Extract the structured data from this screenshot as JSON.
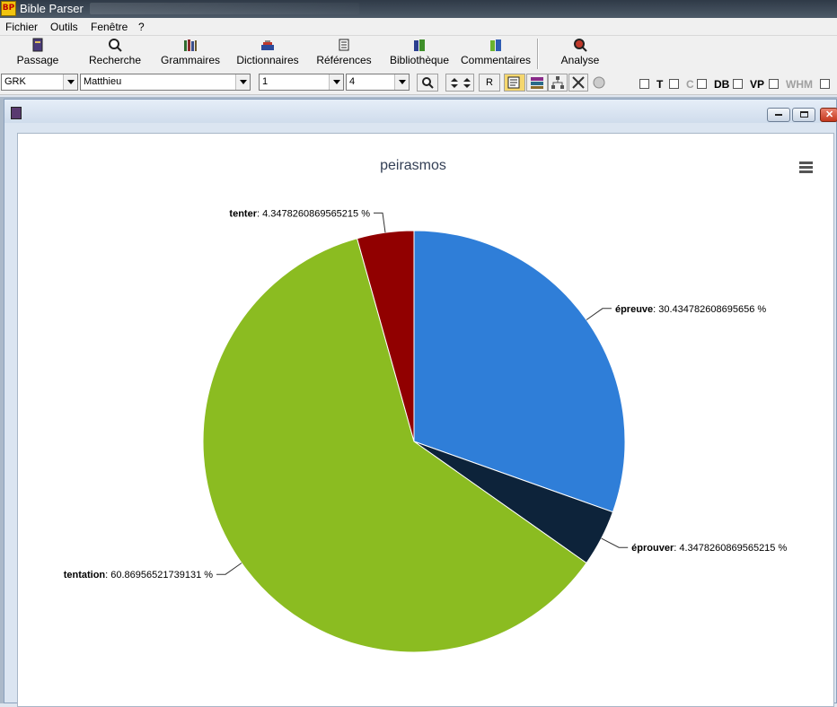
{
  "app": {
    "title": "Bible Parser",
    "icon_text": "BP"
  },
  "menu": {
    "items": [
      "Fichier",
      "Outils",
      "Fenêtre",
      "?"
    ]
  },
  "toolbar": {
    "buttons": [
      {
        "label": "Passage",
        "icon": "book-icon"
      },
      {
        "label": "Recherche",
        "icon": "magnifier-icon"
      },
      {
        "label": "Grammaires",
        "icon": "books-icon"
      },
      {
        "label": "Dictionnaires",
        "icon": "dictionary-icon"
      },
      {
        "label": "Références",
        "icon": "scroll-icon"
      },
      {
        "label": "Bibliothèque",
        "icon": "library-icon"
      },
      {
        "label": "Commentaires",
        "icon": "commentary-icon"
      },
      {
        "label": "Analyse",
        "icon": "analysis-icon"
      }
    ]
  },
  "selectors": {
    "version": "GRK",
    "book": "Matthieu",
    "chapter": "1",
    "verse": "4",
    "r_button": "R"
  },
  "options": [
    {
      "label": "T",
      "dim": false
    },
    {
      "label": "C",
      "dim": true
    },
    {
      "label": "DB",
      "dim": false
    },
    {
      "label": "VP",
      "dim": false
    },
    {
      "label": "WHM",
      "dim": true
    }
  ],
  "colors": {
    "épreuve": "#2f7ed8",
    "éprouver": "#0d233a",
    "tentation": "#8bbc21",
    "tenter": "#910000"
  },
  "chart_data": {
    "type": "pie",
    "title": "peirasmos",
    "series": [
      {
        "slices": [
          {
            "name": "épreuve",
            "value": 30.434782608695656,
            "label": "30.434782608695656 %"
          },
          {
            "name": "éprouver",
            "value": 4.3478260869565215,
            "label": "4.3478260869565215 %"
          },
          {
            "name": "tentation",
            "value": 60.86956521739131,
            "label": "60.86956521739131 %"
          },
          {
            "name": "tenter",
            "value": 4.3478260869565215,
            "label": "4.3478260869565215 %"
          }
        ]
      }
    ]
  }
}
